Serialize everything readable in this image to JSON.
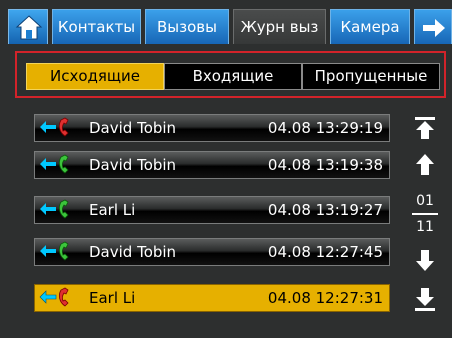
{
  "tabs": [
    {
      "label": "Контакты"
    },
    {
      "label": "Вызовы"
    },
    {
      "label": "Журн выз"
    },
    {
      "label": "Камера"
    }
  ],
  "filters": [
    {
      "label": "Исходящие"
    },
    {
      "label": "Входящие"
    },
    {
      "label": "Пропущенные"
    }
  ],
  "calls": [
    {
      "name": "David Tobin",
      "datetime": "04.08 13:29:19",
      "icon": "outgoing-call-red-icon"
    },
    {
      "name": "David Tobin",
      "datetime": "04.08 13:19:38",
      "icon": "outgoing-call-green-icon"
    },
    {
      "name": "Earl Li",
      "datetime": "04.08 13:19:27",
      "icon": "outgoing-call-green-icon"
    },
    {
      "name": "David Tobin",
      "datetime": "04.08 12:27:45",
      "icon": "outgoing-call-green-icon"
    },
    {
      "name": "Earl Li",
      "datetime": "04.08 12:27:31",
      "icon": "outgoing-call-red-icon"
    }
  ],
  "pagination": {
    "current": "01",
    "total": "11"
  },
  "colors": {
    "tab_blue": "#1e7fd0",
    "accent_yellow": "#e6b000",
    "highlight_red": "#d2232a",
    "arrow_cyan": "#00c8ff",
    "phone_green": "#3cc43c",
    "phone_red": "#e03030"
  }
}
